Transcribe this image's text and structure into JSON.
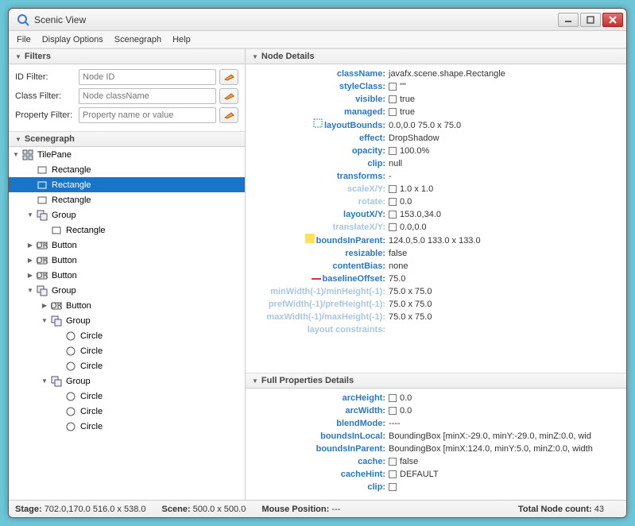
{
  "window": {
    "title": "Scenic View"
  },
  "menubar": {
    "items": [
      "File",
      "Display Options",
      "Scenegraph",
      "Help"
    ]
  },
  "sections": {
    "filters": "Filters",
    "scenegraph": "Scenegraph",
    "nodeDetails": "Node Details",
    "fullProps": "Full Properties Details"
  },
  "filters": {
    "id": {
      "label": "ID Filter:",
      "placeholder": "Node ID"
    },
    "class": {
      "label": "Class Filter:",
      "placeholder": "Node className"
    },
    "property": {
      "label": "Property Filter:",
      "placeholder": "Property name or value"
    }
  },
  "tree": [
    {
      "depth": 0,
      "arrow": "▼",
      "icon": "tile",
      "label": "TilePane",
      "sel": false
    },
    {
      "depth": 1,
      "arrow": "",
      "icon": "rect",
      "label": "Rectangle",
      "sel": false
    },
    {
      "depth": 1,
      "arrow": "",
      "icon": "rect",
      "label": "Rectangle",
      "sel": true
    },
    {
      "depth": 1,
      "arrow": "",
      "icon": "rect",
      "label": "Rectangle",
      "sel": false
    },
    {
      "depth": 1,
      "arrow": "▼",
      "icon": "group",
      "label": "Group",
      "sel": false
    },
    {
      "depth": 2,
      "arrow": "",
      "icon": "rect",
      "label": "Rectangle",
      "sel": false
    },
    {
      "depth": 1,
      "arrow": "▶",
      "icon": "ok",
      "label": "Button",
      "sel": false
    },
    {
      "depth": 1,
      "arrow": "▶",
      "icon": "ok",
      "label": "Button",
      "sel": false
    },
    {
      "depth": 1,
      "arrow": "▶",
      "icon": "ok",
      "label": "Button",
      "sel": false
    },
    {
      "depth": 1,
      "arrow": "▼",
      "icon": "group",
      "label": "Group",
      "sel": false
    },
    {
      "depth": 2,
      "arrow": "▶",
      "icon": "ok",
      "label": "Button",
      "sel": false
    },
    {
      "depth": 2,
      "arrow": "▼",
      "icon": "group",
      "label": "Group",
      "sel": false
    },
    {
      "depth": 3,
      "arrow": "",
      "icon": "circle",
      "label": "Circle",
      "sel": false
    },
    {
      "depth": 3,
      "arrow": "",
      "icon": "circle",
      "label": "Circle",
      "sel": false
    },
    {
      "depth": 3,
      "arrow": "",
      "icon": "circle",
      "label": "Circle",
      "sel": false
    },
    {
      "depth": 2,
      "arrow": "▼",
      "icon": "group",
      "label": "Group",
      "sel": false
    },
    {
      "depth": 3,
      "arrow": "",
      "icon": "circle",
      "label": "Circle",
      "sel": false
    },
    {
      "depth": 3,
      "arrow": "",
      "icon": "circle",
      "label": "Circle",
      "sel": false
    },
    {
      "depth": 3,
      "arrow": "",
      "icon": "circle",
      "label": "Circle",
      "sel": false
    }
  ],
  "nodeDetails": [
    {
      "key": "className:",
      "val": "javafx.scene.shape.Rectangle",
      "muted": false
    },
    {
      "key": "styleClass:",
      "val": "\"\"",
      "muted": false,
      "swatch": true
    },
    {
      "key": "visible:",
      "val": "true",
      "muted": false,
      "swatch": true
    },
    {
      "key": "managed:",
      "val": "true",
      "muted": false,
      "swatch": true
    },
    {
      "key": "layoutBounds:",
      "val": "0.0,0.0  75.0 x 75.0",
      "muted": false,
      "prefix": "dash-green"
    },
    {
      "key": "effect:",
      "val": "DropShadow",
      "muted": false
    },
    {
      "key": "opacity:",
      "val": "100.0%",
      "muted": false,
      "swatch": true
    },
    {
      "key": "clip:",
      "val": "null",
      "muted": false
    },
    {
      "key": "transforms:",
      "val": "-",
      "muted": false
    },
    {
      "key": "scaleX/Y:",
      "val": "1.0 x 1.0",
      "muted": true,
      "swatch": true
    },
    {
      "key": "rotate:",
      "val": "0.0",
      "muted": true,
      "swatch": true
    },
    {
      "key": "layoutX/Y:",
      "val": "153.0,34.0",
      "muted": false,
      "swatch": true
    },
    {
      "key": "translateX/Y:",
      "val": "0.0,0.0",
      "muted": true,
      "swatch": true
    },
    {
      "key": "boundsInParent:",
      "val": "124.0,5.0  133.0 x 133.0",
      "muted": false,
      "prefix": "yellow"
    },
    {
      "key": "resizable:",
      "val": "false",
      "muted": false
    },
    {
      "key": "contentBias:",
      "val": "none",
      "muted": false
    },
    {
      "key": "baselineOffset:",
      "val": "75.0",
      "muted": false,
      "prefix": "red-line"
    },
    {
      "key": "minWidth(-1)/minHeight(-1):",
      "val": "75.0 x 75.0",
      "muted": true
    },
    {
      "key": "prefWidth(-1)/prefHeight(-1):",
      "val": "75.0 x 75.0",
      "muted": true
    },
    {
      "key": "maxWidth(-1)/maxHeight(-1):",
      "val": "75.0 x 75.0",
      "muted": true
    },
    {
      "key": "layout constraints:",
      "val": "",
      "muted": true
    }
  ],
  "fullProps": [
    {
      "key": "arcHeight:",
      "val": "0.0",
      "swatch": true
    },
    {
      "key": "arcWidth:",
      "val": "0.0",
      "swatch": true
    },
    {
      "key": "blendMode:",
      "val": "----"
    },
    {
      "key": "boundsInLocal:",
      "val": "BoundingBox [minX:-29.0, minY:-29.0, minZ:0.0, wid"
    },
    {
      "key": "boundsInParent:",
      "val": "BoundingBox [minX:124.0, minY:5.0, minZ:0.0, width"
    },
    {
      "key": "cache:",
      "val": "false",
      "swatch": true
    },
    {
      "key": "cacheHint:",
      "val": "DEFAULT",
      "swatch": true
    },
    {
      "key": "clip:",
      "val": "",
      "swatch": true
    }
  ],
  "footer": {
    "stageLabel": "Stage:",
    "stageVal": "702.0,170.0  516.0 x 538.0",
    "sceneLabel": "Scene:",
    "sceneVal": "500.0 x 500.0",
    "mouseLabel": "Mouse Position:",
    "mouseVal": "---",
    "countLabel": "Total Node count:",
    "countVal": "43"
  }
}
